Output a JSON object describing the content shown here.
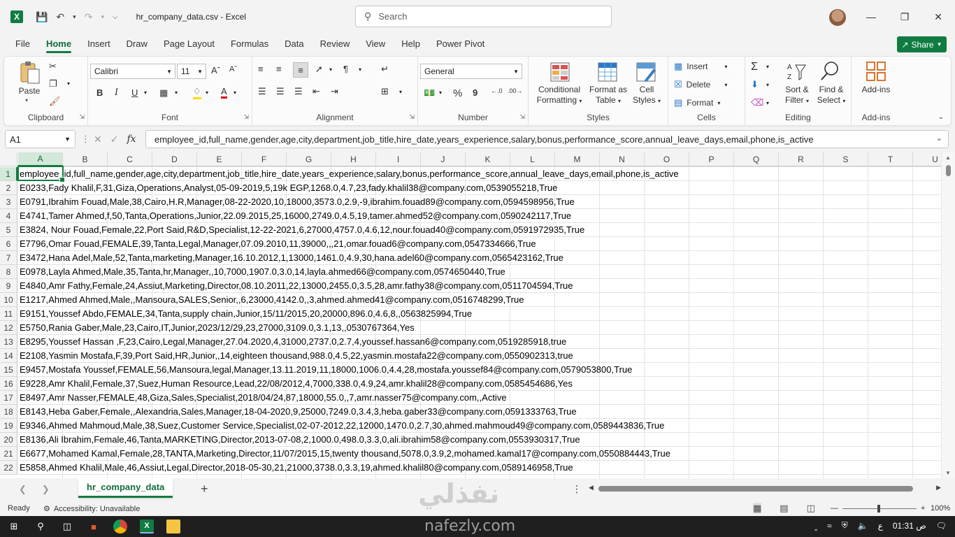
{
  "window": {
    "title": "hr_company_data.csv  -  Excel",
    "search_placeholder": "Search"
  },
  "ribbon_tabs": [
    "File",
    "Home",
    "Insert",
    "Draw",
    "Page Layout",
    "Formulas",
    "Data",
    "Review",
    "View",
    "Help",
    "Power Pivot"
  ],
  "share_label": "Share",
  "ribbon": {
    "clipboard": {
      "label": "Clipboard",
      "paste": "Paste"
    },
    "font": {
      "label": "Font",
      "name": "Calibri",
      "size": "11"
    },
    "alignment": {
      "label": "Alignment"
    },
    "number": {
      "label": "Number",
      "format": "General"
    },
    "styles": {
      "label": "Styles",
      "conditional": [
        "Conditional",
        "Formatting"
      ],
      "format_table": [
        "Format as",
        "Table"
      ],
      "cell_styles": [
        "Cell",
        "Styles"
      ]
    },
    "cells": {
      "label": "Cells",
      "insert": "Insert",
      "delete": "Delete",
      "format": "Format"
    },
    "editing": {
      "label": "Editing",
      "sort": [
        "Sort &",
        "Filter"
      ],
      "find": [
        "Find &",
        "Select"
      ]
    },
    "addins": {
      "label": "Add-ins",
      "button": "Add-ins"
    }
  },
  "formula_bar": {
    "name_box": "A1",
    "formula": "employee_id,full_name,gender,age,city,department,job_title,hire_date,years_experience,salary,bonus,performance_score,annual_leave_days,email,phone,is_active"
  },
  "columns": [
    "A",
    "B",
    "C",
    "D",
    "E",
    "F",
    "G",
    "H",
    "I",
    "J",
    "K",
    "L",
    "M",
    "N",
    "O",
    "P",
    "Q",
    "R",
    "S",
    "T",
    "U"
  ],
  "rows": [
    "employee_id,full_name,gender,age,city,department,job_title,hire_date,years_experience,salary,bonus,performance_score,annual_leave_days,email,phone,is_active",
    "E0233,Fady Khalil,F,31,Giza,Operations,Analyst,05-09-2019,5,19k EGP,1268.0,4.7,23,fady.khalil38@company.com,0539055218,True",
    "E0791,Ibrahim Fouad,Male,38,Cairo,H.R,Manager,08-22-2020,10,18000,3573.0,2.9,-9,ibrahim.fouad89@company.com,0594598956,True",
    "E4741,Tamer Ahmed,f,50,Tanta,Operations,Junior,22.09.2015,25,16000,2749.0,4.5,19,tamer.ahmed52@company.com,0590242117,True",
    "E3824,  Nour Fouad,Female,22,Port Said,R&D,Specialist,12-22-2021,6,27000,4757.0,4.6,12,nour.fouad40@company.com,0591972935,True",
    "E7796,Omar Fouad,FEMALE,39,Tanta,Legal,Manager,07.09.2010,11,39000,,,21,omar.fouad6@company.com,0547334666,True",
    "E3472,Hana Adel,Male,52,Tanta,marketing,Manager,16.10.2012,1,13000,1461.0,4.9,30,hana.adel60@company.com,0565423162,True",
    "E0978,Layla Ahmed,Male,35,Tanta,hr,Manager,,10,7000,1907.0,3.0,14,layla.ahmed66@company.com,0574650440,True",
    "E4840,Amr Fathy,Female,24,Assiut,Marketing,Director,08.10.2011,22,13000,2455.0,3.5,28,amr.fathy38@company.com,0511704594,True",
    "E1217,Ahmed Ahmed,Male,,Mansoura,SALES,Senior,,6,23000,4142.0,,3,ahmed.ahmed41@company.com,0516748299,True",
    "E9151,Youssef Abdo,FEMALE,34,Tanta,supply chain,Junior,15/11/2015,20,20000,896.0,4.6,8,,0563825994,True",
    "E5750,Rania Gaber,Male,23,Cairo,IT,Junior,2023/12/29,23,27000,3109.0,3.1,13,,0530767364,Yes",
    "E8295,Youssef Hassan  ,F,23,Cairo,Legal,Manager,27.04.2020,4,31000,2737.0,2.7,4,youssef.hassan6@company.com,0519285918,true",
    "E2108,Yasmin Mostafa,F,39,Port Said,HR,Junior,,14,eighteen thousand,988.0,4.5,22,yasmin.mostafa22@company.com,0550902313,true",
    "E9457,Mostafa Youssef,FEMALE,56,Mansoura,legal,Manager,13.11.2019,11,18000,1006.0,4.4,28,mostafa.youssef84@company.com,0579053800,True",
    "E9228,Amr Khalil,Female,37,Suez,Human Resource,Lead,22/08/2012,4,7000,338.0,4.9,24,amr.khalil28@company.com,0585454686,Yes",
    "E8497,Amr Nasser,FEMALE,48,Giza,Sales,Specialist,2018/04/24,87,18000,55.0,,7,amr.nasser75@company.com,,Active",
    "E8143,Heba Gaber,Female,,Alexandria,Sales,Manager,18-04-2020,9,25000,7249.0,3.4,3,heba.gaber33@company.com,0591333763,True",
    "E9346,Ahmed Mahmoud,Male,38,Suez,Customer Service,Specialist,02-07-2012,22,12000,1470.0,2.7,30,ahmed.mahmoud49@company.com,0589443836,True",
    "E8136,Ali Ibrahim,Female,46,Tanta,MARKETING,Director,2013-07-08,2,1000.0,498.0,3.3,0,ali.ibrahim58@company.com,0553930317,True",
    "E6677,Mohamed Kamal,Female,28,TANTA,Marketing,Director,11/07/2015,15,twenty thousand,5078.0,3.9,2,mohamed.kamal17@company.com,0550884443,True",
    "E5858,Ahmed Khalil,Male,46,Assiut,Legal,Director,2018-05-30,21,21000,3738.0,3.3,19,ahmed.khalil80@company.com,0589146958,True"
  ],
  "sheet_tab": "hr_company_data",
  "status": {
    "ready": "Ready",
    "accessibility": "Accessibility: Unavailable",
    "zoom": "100%"
  },
  "taskbar": {
    "lang": "ع",
    "time": "01:31 ص"
  },
  "watermark": {
    "arabic": "نفذلي",
    "latin": "nafezly.com"
  }
}
